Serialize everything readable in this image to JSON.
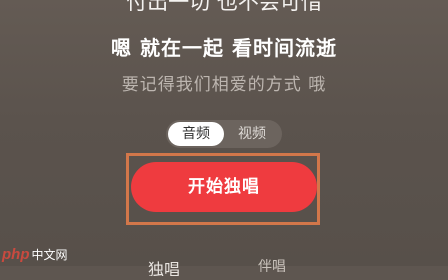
{
  "lyrics": {
    "previous": "付出一切 也不会可惜",
    "current": "嗯 就在一起 看时间流逝",
    "next": "要记得我们相爱的方式 哦"
  },
  "mode_toggle": {
    "audio_label": "音频",
    "video_label": "视频",
    "selected": "音频"
  },
  "start_button": {
    "label": "开始独唱"
  },
  "bottom": {
    "left_text": "独唱",
    "right_text": "伴唱"
  },
  "watermark": {
    "logo": "php",
    "text": "中文网"
  },
  "colors": {
    "background": "#5e5650",
    "accent_red": "#ef3b3f",
    "highlight_border": "#d2774a"
  }
}
